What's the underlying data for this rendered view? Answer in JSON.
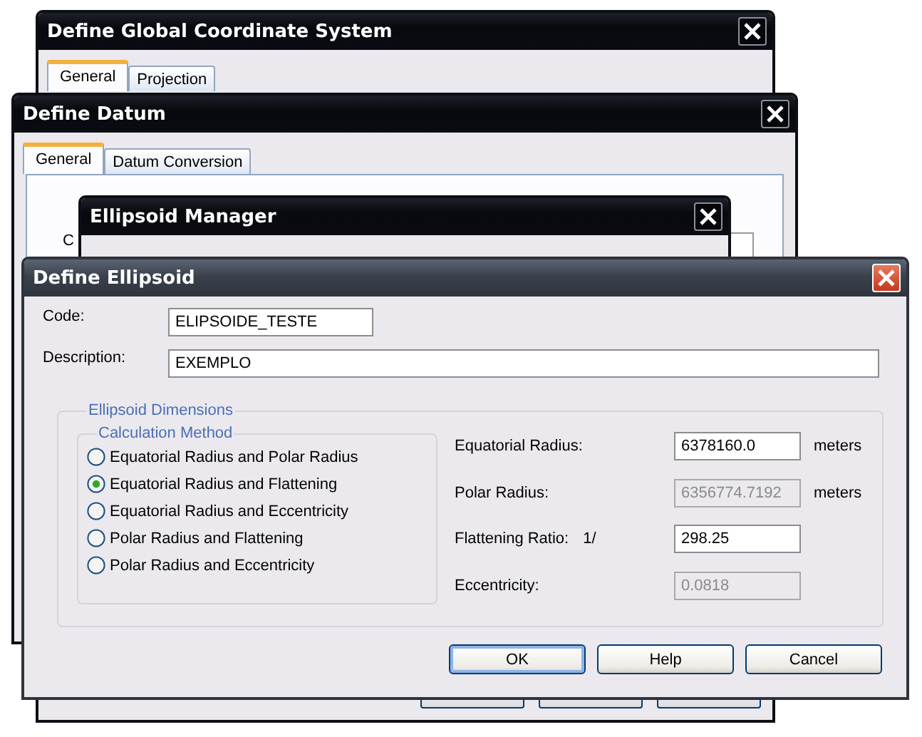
{
  "background_windows": [
    {
      "title": "Define Global Coordinate System",
      "tabs": [
        {
          "label": "General",
          "selected": true
        },
        {
          "label": "Projection",
          "selected": false
        }
      ]
    },
    {
      "title": "Define Datum",
      "tabs": [
        {
          "label": "General",
          "selected": true
        },
        {
          "label": "Datum Conversion",
          "selected": false
        }
      ],
      "partial_label": "C"
    },
    {
      "title": "Ellipsoid Manager"
    }
  ],
  "dialog": {
    "title": "Define Ellipsoid",
    "fields": [
      {
        "label": "Code:",
        "value": "ELIPSOIDE_TESTE",
        "kind": "short"
      },
      {
        "label": "Description:",
        "value": "EXEMPLO",
        "kind": "wide"
      }
    ],
    "group_title": "Ellipsoid Dimensions",
    "method_title": "Calculation Method",
    "methods": [
      {
        "label": "Equatorial Radius and Polar Radius",
        "selected": false
      },
      {
        "label": "Equatorial Radius and Flattening",
        "selected": true
      },
      {
        "label": "Equatorial Radius and Eccentricity",
        "selected": false
      },
      {
        "label": "Polar Radius and Flattening",
        "selected": false
      },
      {
        "label": "Polar Radius and Eccentricity",
        "selected": false
      }
    ],
    "parameters": [
      {
        "label": "Equatorial Radius:",
        "value": "6378160.0",
        "disabled": false,
        "unit": "meters"
      },
      {
        "label": "Polar Radius:",
        "value": "6356774.7192",
        "disabled": true,
        "unit": "meters"
      },
      {
        "label": "Flattening Ratio:",
        "prefix": "1/",
        "value": "298.25",
        "disabled": false
      },
      {
        "label": "Eccentricity:",
        "value": "0.0818",
        "disabled": true
      }
    ],
    "buttons": [
      {
        "label": "OK",
        "default": true
      },
      {
        "label": "Help",
        "default": false
      },
      {
        "label": "Cancel",
        "default": false
      }
    ]
  }
}
